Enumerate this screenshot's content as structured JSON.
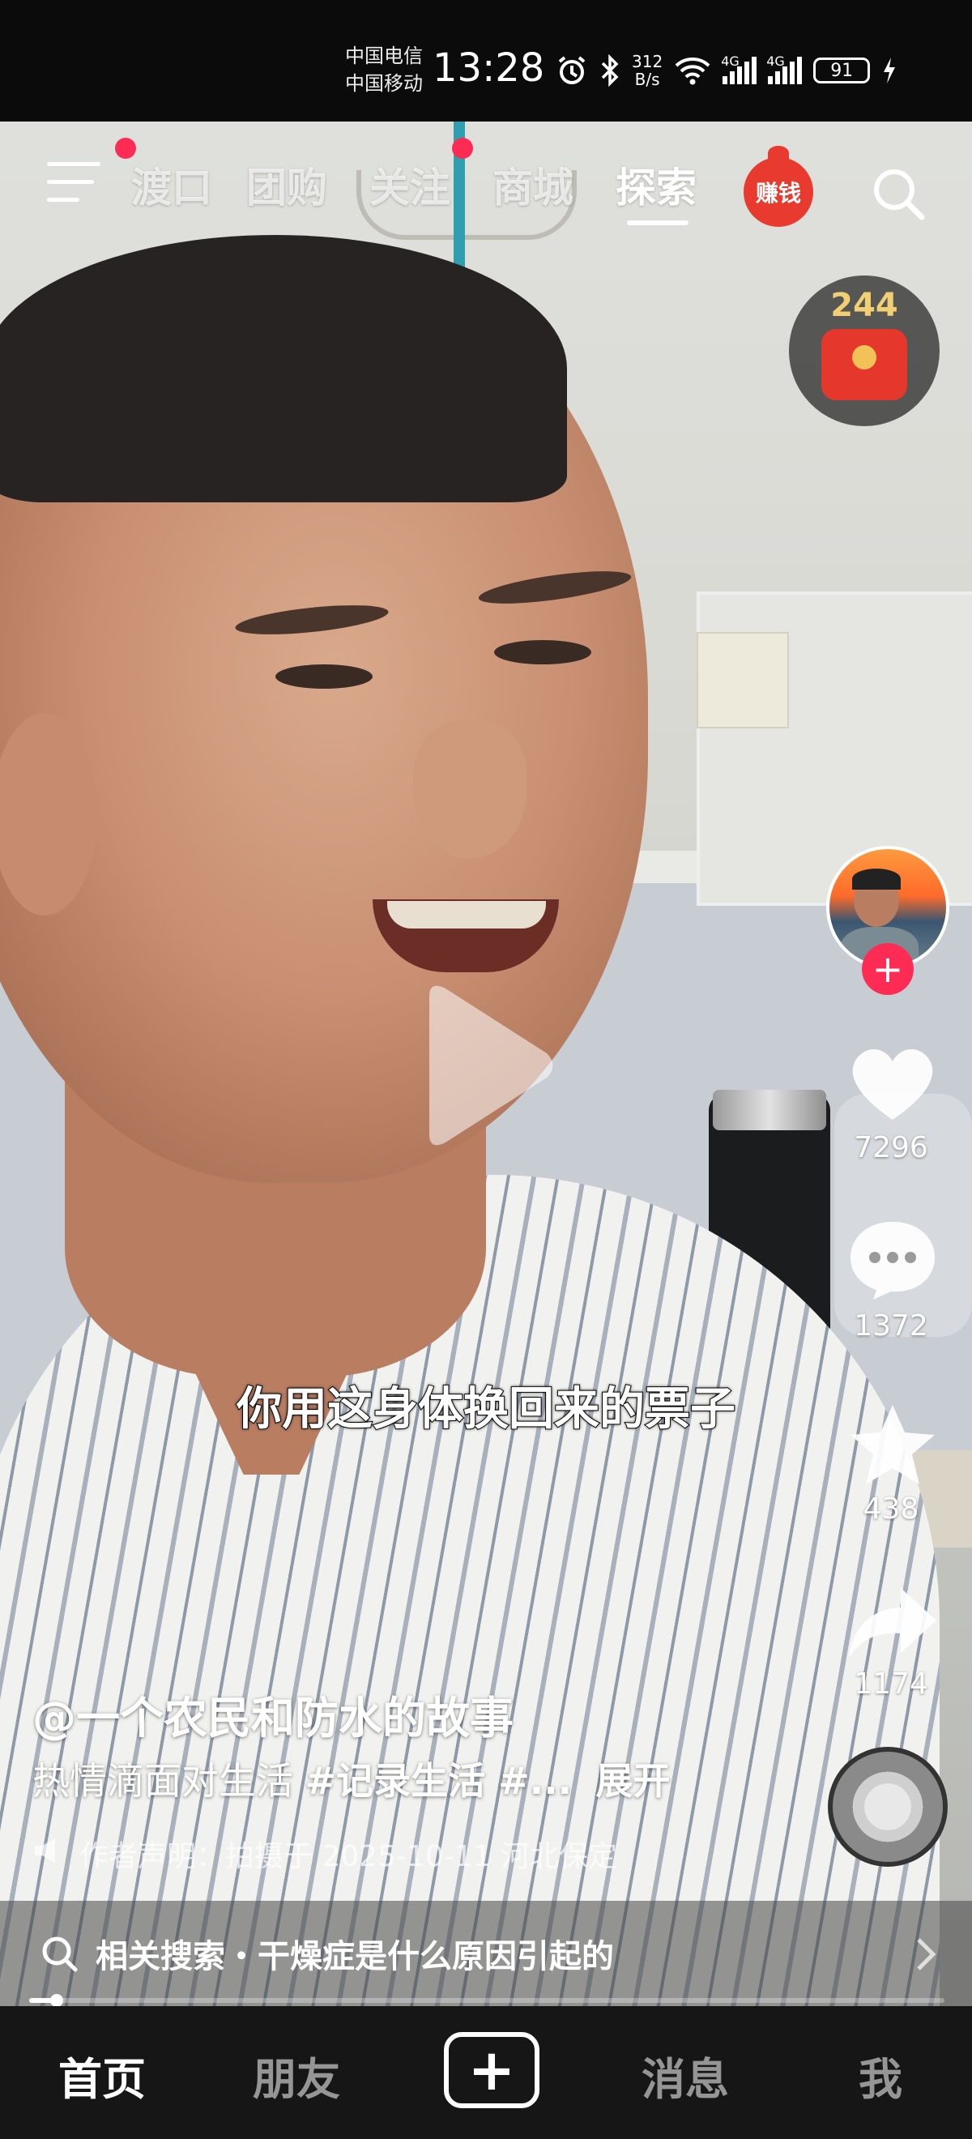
{
  "status_bar": {
    "carrier_1": "中国电信",
    "carrier_2": "中国移动",
    "time": "13:28",
    "net_speed_value": "312",
    "net_speed_unit": "B/s",
    "signal_1_label": "4G",
    "signal_2_label": "4G",
    "battery": "91"
  },
  "top_nav": {
    "tabs": [
      "渡口",
      "团购",
      "关注",
      "商城",
      "探索"
    ],
    "active_tab": "探索",
    "earn_label": "赚钱"
  },
  "coin_widget": {
    "count": "244"
  },
  "video": {
    "subtitle": "你用这身体换回来的票子",
    "author": "@一个农民和防水的故事",
    "desc_text": "热情滴面对生活 ",
    "desc_tag_1": "#记录生活",
    "desc_tag_2": " #...",
    "desc_expand": "展开",
    "statement": "作者声明：拍摄于 2025-10-11 河北保定",
    "progress": 0.03
  },
  "right_rail": {
    "likes": "7296",
    "comments": "1372",
    "favorites": "438",
    "shares": "1174"
  },
  "related_search": {
    "text": "相关搜索・干燥症是什么原因引起的"
  },
  "bottom_nav": {
    "home": "首页",
    "friends": "朋友",
    "messages": "消息",
    "me": "我"
  },
  "colors": {
    "accent": "#fe2c55",
    "coin_gold": "#f3cf74",
    "earn_red": "#e83a2e"
  }
}
